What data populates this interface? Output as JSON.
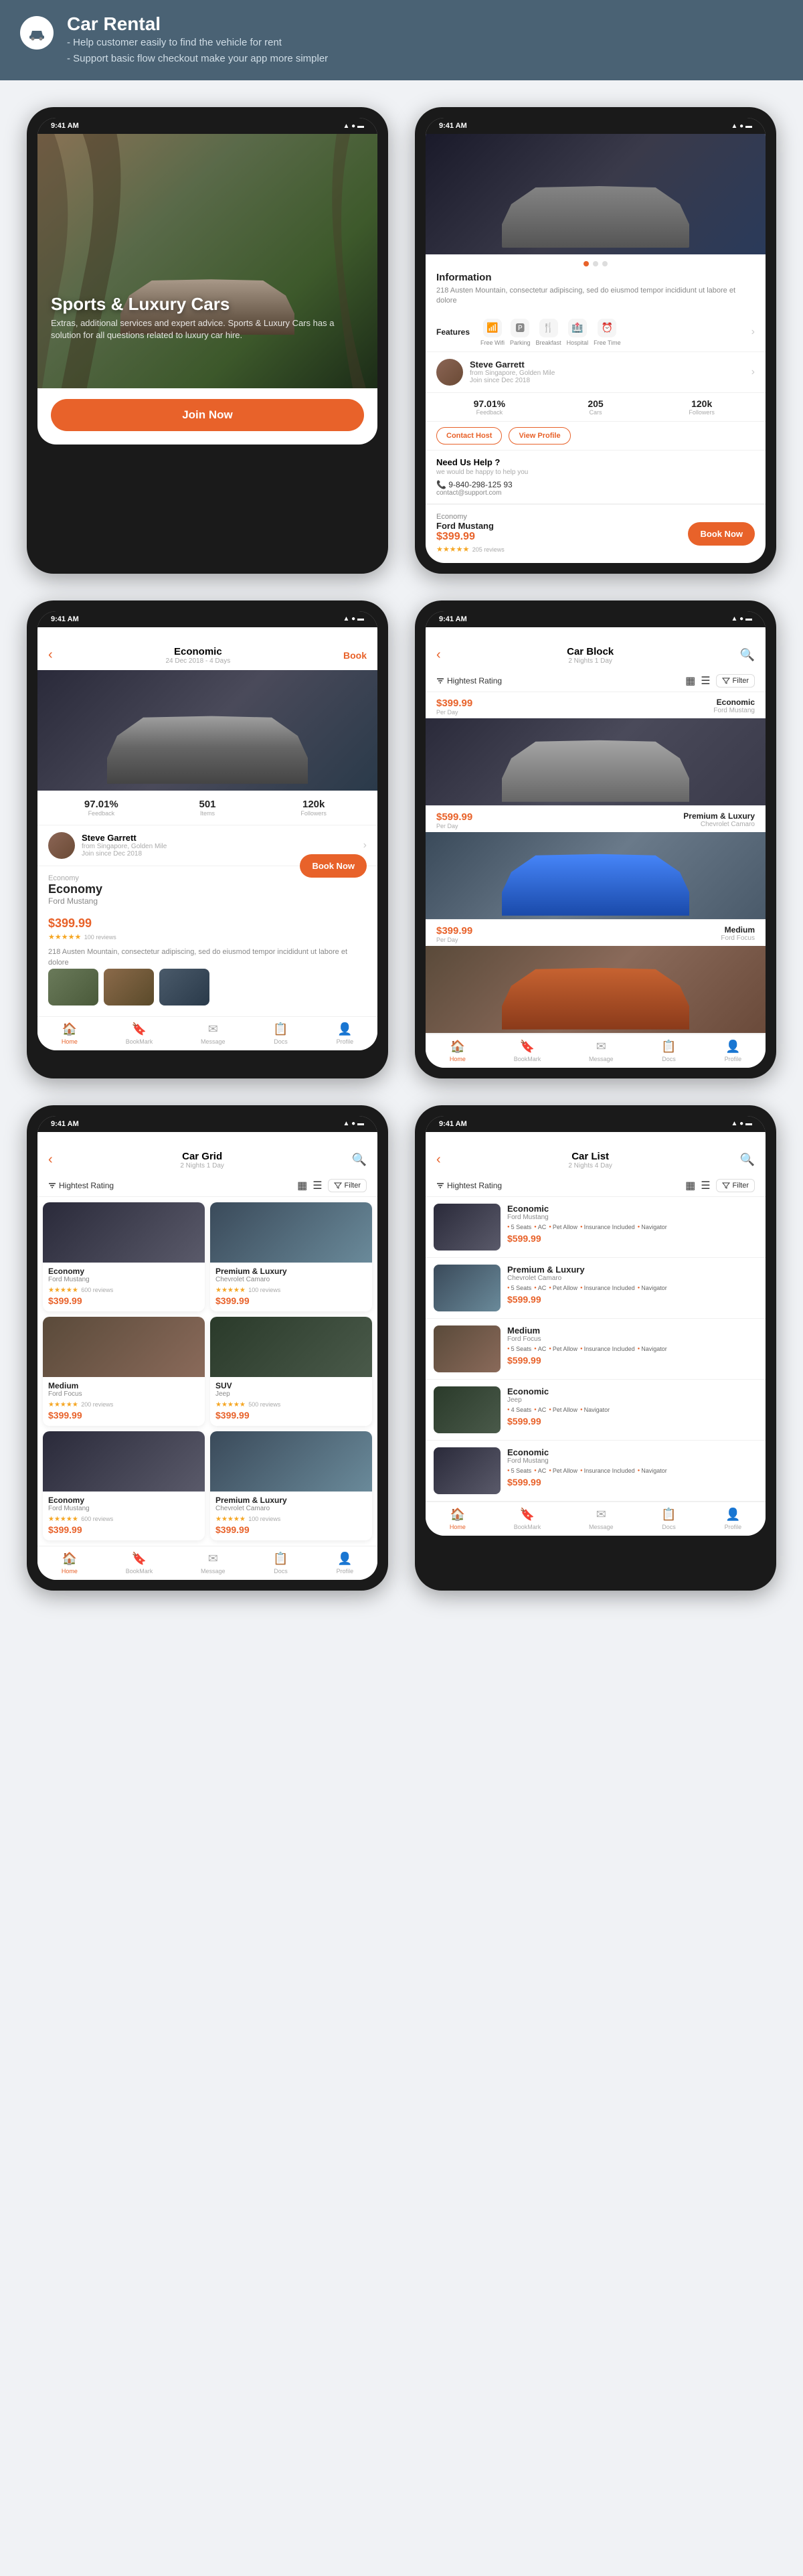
{
  "header": {
    "icon": "🚗",
    "title": "Car Rental",
    "desc1": "- Help customer easily to find the vehicle for rent",
    "desc2": "- Support basic flow checkout make your app more simpler"
  },
  "screen1": {
    "hero_title": "Sports & Luxury Cars",
    "hero_sub": "Extras, additional services and expert advice. Sports & Luxury Cars has a solution for all questions related to luxury car hire.",
    "join_btn": "Join Now",
    "time": "9:41 AM"
  },
  "screen2": {
    "time": "9:41 AM",
    "section_info": "Information",
    "info_text": "218 Austen Mountain, consectetur adipiscing, sed do eiusmod tempor incididunt ut labore et dolore",
    "features_label": "Features",
    "features": [
      "Free Wifi",
      "Parking",
      "Breakfast",
      "Hospital",
      "Free Time"
    ],
    "host_name": "Steve Garrett",
    "host_from": "from Singapore, Golden Mile",
    "host_join": "Join since Dec 2018",
    "stat1_val": "97.01%",
    "stat1_label": "Feedback",
    "stat2_val": "205",
    "stat2_label": "Cars",
    "stat3_val": "120k",
    "stat3_label": "Followers",
    "btn_contact": "Contact Host",
    "btn_view": "View Profile",
    "help_title": "Need Us Help ?",
    "help_sub": "we would be happy to help you",
    "help_phone": "📞 9-840-298-125 93",
    "help_email": "contact@support.com",
    "booking_label": "Economy",
    "booking_model": "Ford Mustang",
    "booking_price": "$399.99",
    "book_btn": "Book Now",
    "stars": "★★★★★",
    "reviews": "205 reviews"
  },
  "screen3": {
    "time": "9:41 AM",
    "title": "Economic",
    "subtitle": "24 Dec 2018 - 4 Days",
    "book_link": "Book",
    "stat1_val": "97.01%",
    "stat1_label": "Feedback",
    "stat2_val": "501",
    "stat2_label": "Items",
    "stat3_val": "120k",
    "stat3_label": "Followers",
    "host_name": "Steve Garrett",
    "host_from": "from Singapore, Golden Mile",
    "host_join": "Join since Dec 2018",
    "car_label": "Economy",
    "car_name": "Economy",
    "car_model": "Ford Mustang",
    "book_btn": "Book Now",
    "price": "$399.99",
    "stars": "★★★★★",
    "reviews": "100 reviews",
    "desc": "218 Austen Mountain, consectetur adipiscing, sed do eiusmod tempor incididunt ut labore et dolore"
  },
  "screen4": {
    "time": "9:41 AM",
    "title": "Car Block",
    "subtitle": "2 Nights 1 Day",
    "sort": "Hightest Rating",
    "filter": "Filter",
    "item1": {
      "price": "$399.99",
      "per": "Per Day",
      "category": "Economic",
      "model": "Ford Mustang"
    },
    "item2": {
      "price": "$599.99",
      "per": "Per Day",
      "category": "Premium & Luxury",
      "model": "Chevrolet Camaro"
    },
    "item3": {
      "price": "$399.99",
      "per": "Per Day",
      "category": "Medium",
      "model": "Ford Focus"
    }
  },
  "screen5": {
    "time": "9:41 AM",
    "title": "Car Grid",
    "subtitle": "2 Nights 1 Day",
    "sort": "Hightest Rating",
    "filter": "Filter",
    "items": [
      {
        "category": "Economy",
        "model": "Ford Mustang",
        "price": "$399.99",
        "reviews": "600 reviews"
      },
      {
        "category": "Premium & Luxury",
        "model": "Chevrolet Camaro",
        "price": "$399.99",
        "reviews": "100 reviews"
      },
      {
        "category": "Medium",
        "model": "Ford Focus",
        "price": "$399.99",
        "reviews": "200 reviews"
      },
      {
        "category": "SUV",
        "model": "Jeep",
        "price": "$399.99",
        "reviews": "500 reviews"
      },
      {
        "category": "Economy",
        "model": "Ford Mustang",
        "price": "$399.99",
        "reviews": "600 reviews"
      },
      {
        "category": "Premium & Luxury",
        "model": "Chevrolet Camaro",
        "price": "$399.99",
        "reviews": "100 reviews"
      }
    ]
  },
  "screen6": {
    "time": "9:41 AM",
    "title": "Car List",
    "subtitle": "2 Nights 4 Day",
    "sort": "Hightest Rating",
    "filter": "Filter",
    "items": [
      {
        "category": "Economic",
        "model": "Ford Mustang",
        "features": [
          "5 Seats",
          "AC",
          "Pet Allow",
          "Insurance Included",
          "Navigator"
        ],
        "price": "$599.99"
      },
      {
        "category": "Premium & Luxury",
        "model": "Chevrolet Camaro",
        "features": [
          "5 Seats",
          "AC",
          "Pet Allow",
          "Insurance Included",
          "Navigator"
        ],
        "price": "$599.99"
      },
      {
        "category": "Medium",
        "model": "Ford Focus",
        "features": [
          "5 Seats",
          "AC",
          "Pet Allow",
          "Insurance Included",
          "Navigator"
        ],
        "price": "$599.99"
      },
      {
        "category": "Economic",
        "model": "Jeep",
        "features": [
          "4 Seats",
          "AC",
          "Pet Allow",
          "Navigator"
        ],
        "price": "$599.99"
      },
      {
        "category": "Economic",
        "model": "Ford Mustang",
        "features": [
          "5 Seats",
          "AC",
          "Pet Allow",
          "Insurance Included",
          "Navigator"
        ],
        "price": "$599.99"
      }
    ]
  },
  "colors": {
    "accent": "#e8622a",
    "bg_dark": "#4a6274",
    "text_dark": "#222222",
    "text_muted": "#888888"
  }
}
